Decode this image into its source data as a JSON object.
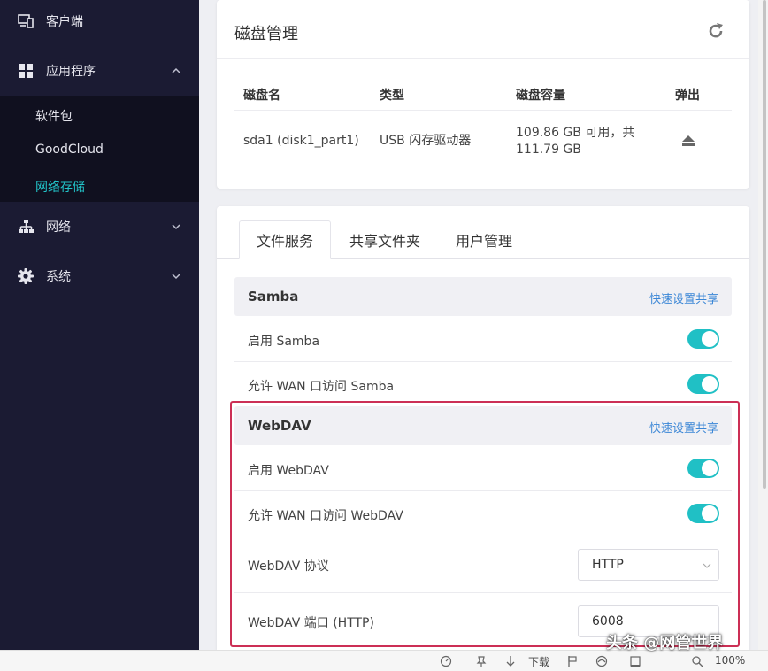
{
  "sidebar": {
    "items": [
      {
        "label": "客户端",
        "icon": "devices-icon"
      },
      {
        "label": "应用程序",
        "icon": "apps-grid-icon",
        "expanded": true
      },
      {
        "label": "网络",
        "icon": "network-icon"
      },
      {
        "label": "系统",
        "icon": "gear-icon"
      }
    ],
    "submenu": [
      {
        "label": "软件包"
      },
      {
        "label": "GoodCloud"
      },
      {
        "label": "网络存储",
        "active": true
      }
    ]
  },
  "disk_card": {
    "title": "磁盘管理",
    "columns": [
      "磁盘名",
      "类型",
      "磁盘容量",
      "弹出"
    ],
    "rows": [
      {
        "name": "sda1 (disk1_part1)",
        "type": "USB 闪存驱动器",
        "capacity_line1": "109.86 GB 可用，共",
        "capacity_line2": "111.79 GB"
      }
    ]
  },
  "service_card": {
    "tabs": [
      "文件服务",
      "共享文件夹",
      "用户管理"
    ],
    "active_tab": 0,
    "samba": {
      "title": "Samba",
      "quick_link": "快速设置共享",
      "enable_label": "启用 Samba",
      "enable_on": true,
      "wan_label": "允许 WAN 口访问 Samba",
      "wan_on": true
    },
    "webdav": {
      "title": "WebDAV",
      "quick_link": "快速设置共享",
      "enable_label": "启用 WebDAV",
      "enable_on": true,
      "wan_label": "允许 WAN 口访问 WebDAV",
      "wan_on": true,
      "protocol_label": "WebDAV 协议",
      "protocol_value": "HTTP",
      "port_label": "WebDAV 端口 (HTTP)",
      "port_value": "6008"
    }
  },
  "statusbar": {
    "download_label": "下载",
    "zoom": "100%"
  },
  "watermark": "头条 @网管世界",
  "colors": {
    "sidebar_bg": "#1b1b33",
    "accent": "#20c0c5",
    "link": "#3a86d6",
    "highlight": "#cc2f55"
  }
}
